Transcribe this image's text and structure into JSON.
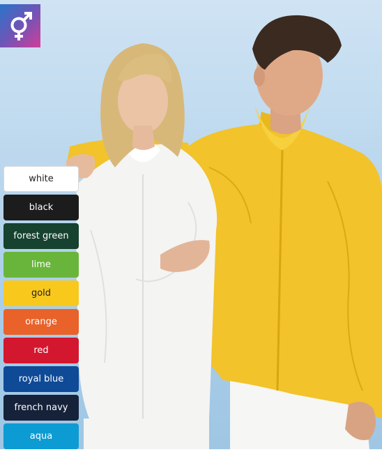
{
  "badge": {
    "icon": "male-female-gender-icon",
    "colors": [
      "#2a74c9",
      "#6b56b8",
      "#d13e98"
    ]
  },
  "photo": {
    "subject": "two-models-wearing-white-and-yellow-jackets"
  },
  "swatches": [
    {
      "label": "white",
      "bg": "#ffffff",
      "fg": "#222222"
    },
    {
      "label": "black",
      "bg": "#1c1c1c",
      "fg": "#ffffff"
    },
    {
      "label": "forest green",
      "bg": "#16422f",
      "fg": "#ffffff"
    },
    {
      "label": "lime",
      "bg": "#69b53b",
      "fg": "#ffffff"
    },
    {
      "label": "gold",
      "bg": "#f8c81c",
      "fg": "#222222"
    },
    {
      "label": "orange",
      "bg": "#e8622a",
      "fg": "#ffffff"
    },
    {
      "label": "red",
      "bg": "#d3172f",
      "fg": "#ffffff"
    },
    {
      "label": "royal blue",
      "bg": "#0f4a97",
      "fg": "#ffffff"
    },
    {
      "label": "french navy",
      "bg": "#16223a",
      "fg": "#ffffff"
    },
    {
      "label": "aqua",
      "bg": "#0d9bd3",
      "fg": "#ffffff"
    }
  ]
}
